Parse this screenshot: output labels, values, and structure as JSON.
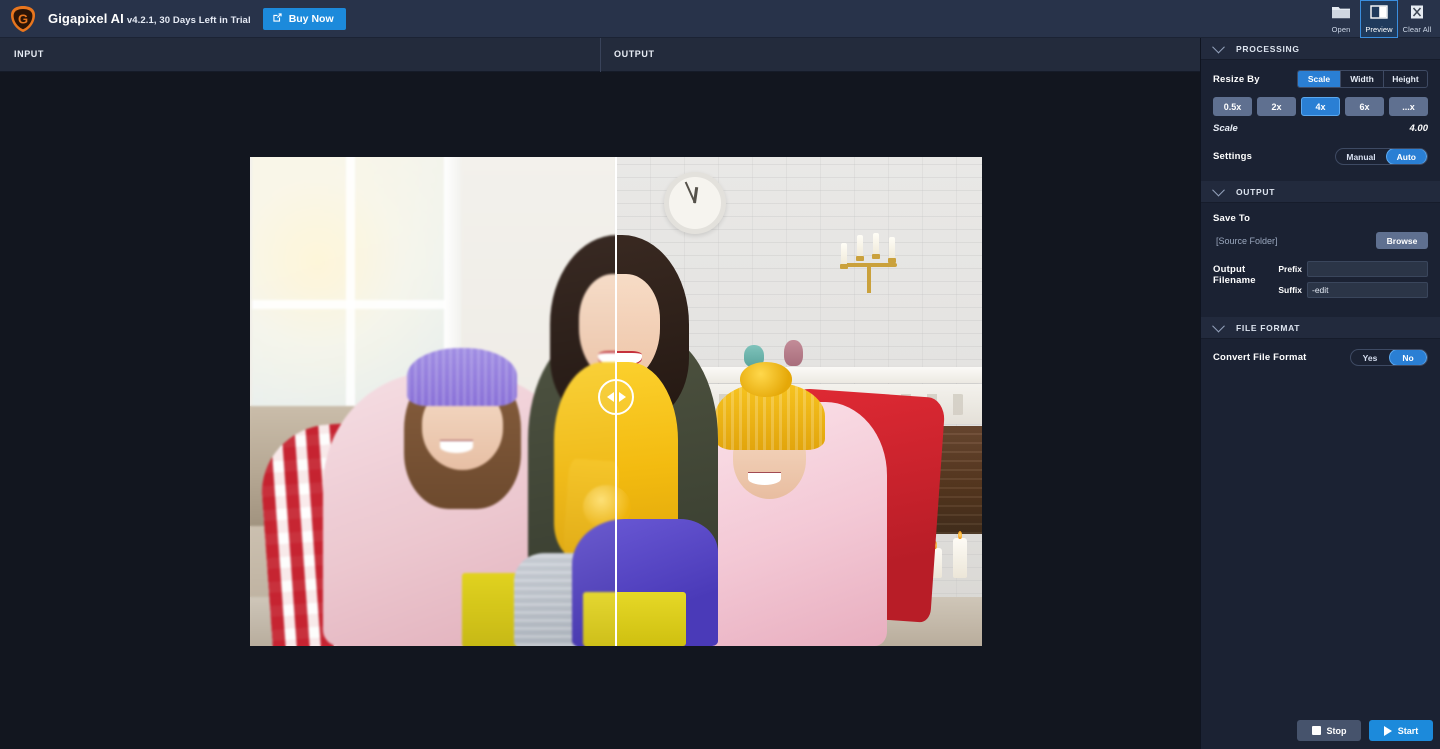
{
  "titlebar": {
    "logo_icon": "gigapixel-logo-icon",
    "app_name": "Gigapixel AI",
    "version_text": "v4.2.1, 30 Days Left in Trial",
    "buy_now_label": "Buy Now",
    "buy_now_icon": "external-link-icon",
    "buy_now_color": "#1c8adb",
    "tools": [
      {
        "label": "Open",
        "icon": "folder-icon",
        "active": false
      },
      {
        "label": "Preview",
        "icon": "split-view-icon",
        "active": true
      },
      {
        "label": "Clear All",
        "icon": "clear-all-x-icon",
        "active": false
      }
    ]
  },
  "tabs": {
    "input_label": "INPUT",
    "output_label": "OUTPUT"
  },
  "viewer": {
    "slider_icon_left": "triangle-left-icon",
    "slider_icon_right": "triangle-right-icon",
    "divider_color": "#ffffff"
  },
  "sidebar": {
    "processing": {
      "title": "PROCESSING",
      "chevron_icon": "chevron-down-icon",
      "resize_by_label": "Resize By",
      "resize_by_options": [
        {
          "label": "Scale",
          "active": true
        },
        {
          "label": "Width",
          "active": false
        },
        {
          "label": "Height",
          "active": false
        }
      ],
      "presets": [
        {
          "label": "0.5x",
          "active": false
        },
        {
          "label": "2x",
          "active": false
        },
        {
          "label": "4x",
          "active": true
        },
        {
          "label": "6x",
          "active": false
        },
        {
          "label": "...x",
          "active": false
        }
      ],
      "scale_key": "Scale",
      "scale_value": "4.00",
      "settings_label": "Settings",
      "settings_options": [
        {
          "label": "Manual",
          "active": false
        },
        {
          "label": "Auto",
          "active": true
        }
      ]
    },
    "output": {
      "title": "OUTPUT",
      "chevron_icon": "chevron-down-icon",
      "save_to_label": "Save To",
      "save_to_value": "[Source Folder]",
      "browse_label": "Browse",
      "output_filename_label": "Output Filename",
      "prefix_key": "Prefix",
      "prefix_value": "",
      "prefix_placeholder": "",
      "suffix_key": "Suffix",
      "suffix_value": "-edit",
      "suffix_placeholder": ""
    },
    "file_format": {
      "title": "FILE FORMAT",
      "chevron_icon": "chevron-down-icon",
      "convert_label": "Convert File Format",
      "convert_options": [
        {
          "label": "Yes",
          "active": false
        },
        {
          "label": "No",
          "active": true
        }
      ]
    },
    "actions": {
      "stop_label": "Stop",
      "stop_icon": "stop-square-icon",
      "start_label": "Start",
      "start_icon": "play-triangle-icon",
      "start_color": "#1c8adb"
    }
  },
  "theme": {
    "accent": "#2a7fd4",
    "titlebar_bg": "#28334a",
    "sidebar_bg": "#1b2233",
    "canvas_bg": "#12161f",
    "logo_orange": "#e8761e"
  }
}
